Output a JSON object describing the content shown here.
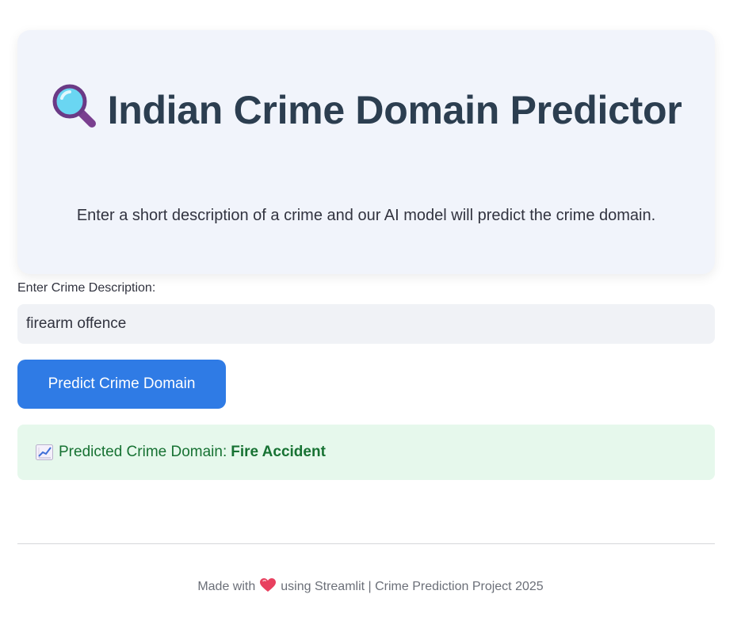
{
  "hero": {
    "title": "Indian Crime Domain Predictor",
    "title_icon": "magnifying-glass-icon",
    "subtitle": "Enter a short description of a crime and our AI model will predict the crime domain."
  },
  "form": {
    "label": "Enter Crime Description:",
    "input_value": "firearm offence",
    "button_label": "Predict Crime Domain"
  },
  "result": {
    "icon": "chart-increasing-icon",
    "prefix": "Predicted Crime Domain:",
    "value": "Fire Accident"
  },
  "footer": {
    "before": "Made with",
    "icon": "heart-icon",
    "after": "using Streamlit | Crime Prediction Project 2025"
  },
  "colors": {
    "hero_bg": "#f1f4fb",
    "title": "#2c3e50",
    "button": "#2f7be5",
    "success_bg": "#e6f8ec",
    "success_text": "#177233"
  }
}
